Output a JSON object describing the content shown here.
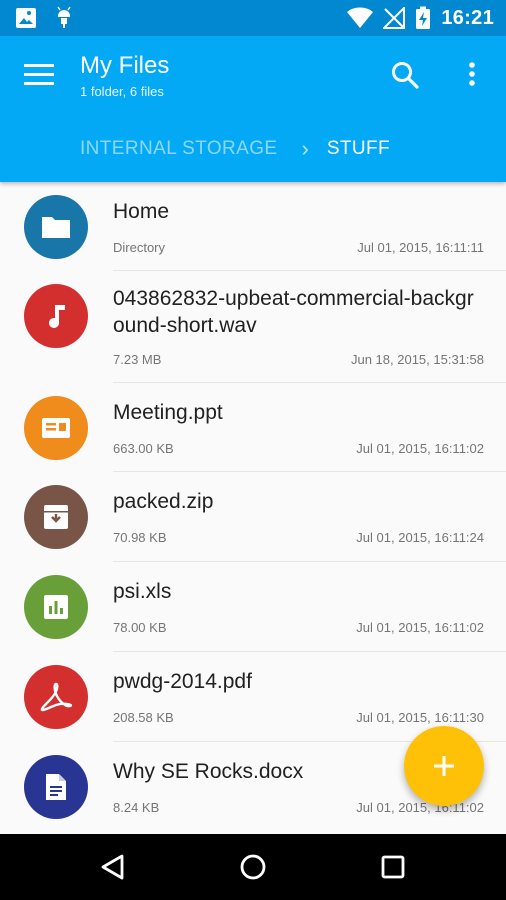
{
  "status_bar": {
    "time": "16:21"
  },
  "app_bar": {
    "title": "My Files",
    "subtitle": "1 folder, 6 files",
    "breadcrumb": [
      "INTERNAL STORAGE",
      "STUFF"
    ]
  },
  "files": [
    {
      "name": "Home",
      "size": "Directory",
      "date": "Jul 01, 2015, 16:11:11",
      "icon": "folder-icon",
      "color": "#1976a8"
    },
    {
      "name": "043862832-upbeat-commercial-background-short.wav",
      "size": "7.23 MB",
      "date": "Jun 18, 2015, 15:31:58",
      "icon": "music-note-icon",
      "color": "#d32f2f"
    },
    {
      "name": "Meeting.ppt",
      "size": "663.00 KB",
      "date": "Jul 01, 2015, 16:11:02",
      "icon": "presentation-icon",
      "color": "#ef8c1c"
    },
    {
      "name": "packed.zip",
      "size": "70.98 KB",
      "date": "Jul 01, 2015, 16:11:24",
      "icon": "archive-icon",
      "color": "#795548"
    },
    {
      "name": "psi.xls",
      "size": "78.00 KB",
      "date": "Jul 01, 2015, 16:11:02",
      "icon": "spreadsheet-icon",
      "color": "#689f38"
    },
    {
      "name": "pwdg-2014.pdf",
      "size": "208.58 KB",
      "date": "Jul 01, 2015, 16:11:30",
      "icon": "pdf-icon",
      "color": "#d32f2f"
    },
    {
      "name": "Why SE Rocks.docx",
      "size": "8.24 KB",
      "date": "Jul 01, 2015, 16:11:02",
      "icon": "document-icon",
      "color": "#283593"
    }
  ],
  "fab": {
    "label": "+",
    "color": "#ffc107"
  },
  "colors": {
    "primary": "#03a9f4",
    "primary_dark": "#0288d1",
    "accent": "#ffc107"
  }
}
